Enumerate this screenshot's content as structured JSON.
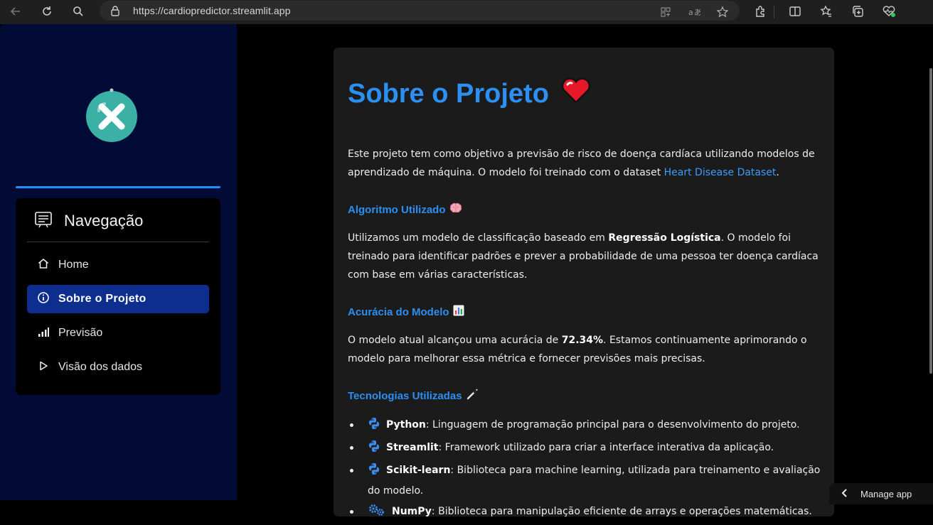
{
  "browser": {
    "url": "https://cardiopredictor.streamlit.app"
  },
  "sidebar": {
    "nav_title": "Navegação",
    "items": [
      {
        "label": "Home",
        "icon": "home-icon"
      },
      {
        "label": "Sobre o Projeto",
        "icon": "info-icon",
        "active": true
      },
      {
        "label": "Previsão",
        "icon": "bar-chart-icon"
      },
      {
        "label": "Visão dos dados",
        "icon": "play-icon"
      }
    ]
  },
  "main": {
    "title": "Sobre o Projeto",
    "title_emoji": "heart-emoji",
    "intro_1": "Este projeto tem como objetivo a previsão de risco de doença cardíaca utilizando modelos de aprendizado de máquina. O modelo foi treinado com o dataset ",
    "intro_link": "Heart Disease Dataset",
    "intro_2": ".",
    "section_algo": {
      "title": "Algoritmo Utilizado",
      "emoji": "brain-emoji",
      "text_1": "Utilizamos um modelo de classificação baseado em ",
      "bold": "Regressão Logística",
      "text_2": ". O modelo foi treinado para identificar padrões e prever a probabilidade de uma pessoa ter doença cardíaca com base em várias características."
    },
    "section_acc": {
      "title": "Acurácia do Modelo",
      "emoji": "bar-chart-emoji",
      "text_1": "O modelo atual alcançou uma acurácia de ",
      "bold": "72.34%",
      "text_2": ". Estamos continuamente aprimorando o modelo para melhorar essa métrica e fornecer previsões mais precisas."
    },
    "section_tech": {
      "title": "Tecnologias Utilizadas",
      "emoji": "wand-emoji",
      "items": [
        {
          "name": "Python",
          "desc": ": Linguagem de programação principal para o desenvolvimento do projeto.",
          "icon": "python-icon"
        },
        {
          "name": "Streamlit",
          "desc": ": Framework utilizado para criar a interface interativa da aplicação.",
          "icon": "python-icon"
        },
        {
          "name": "Scikit-learn",
          "desc": ": Biblioteca para machine learning, utilizada para treinamento e avaliação do modelo.",
          "icon": "python-icon"
        },
        {
          "name": "NumPy",
          "desc": ": Biblioteca para manipulação eficiente de arrays e operações matemáticas.",
          "icon": "gears-icon"
        }
      ]
    }
  },
  "manage_app": {
    "label": "Manage app"
  }
}
